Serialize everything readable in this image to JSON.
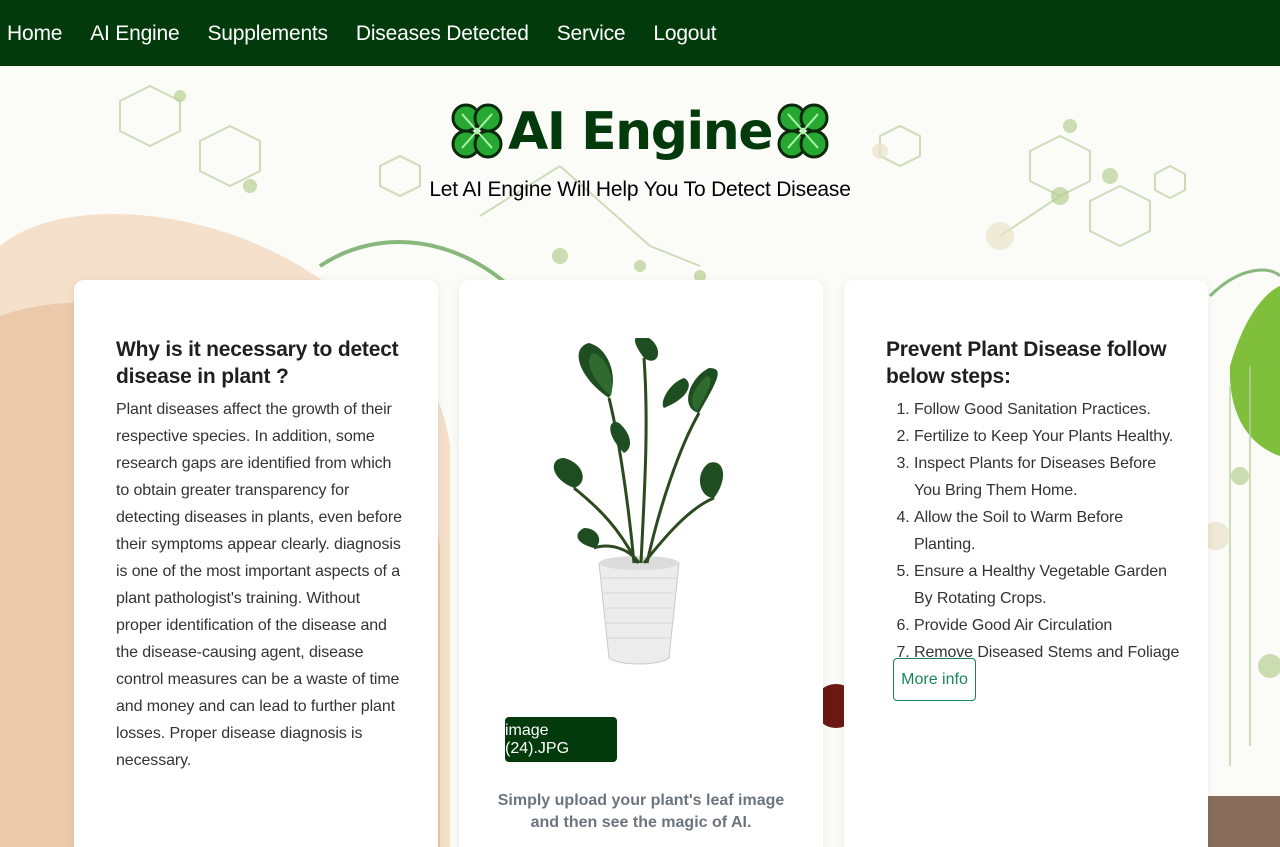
{
  "nav": {
    "items": [
      "Home",
      "AI Engine",
      "Supplements",
      "Diseases Detected",
      "Service",
      "Logout"
    ]
  },
  "header": {
    "title": "AI Engine",
    "subtitle": "Let AI Engine Will Help You To Detect Disease"
  },
  "left_card": {
    "heading": "Why is it necessary to detect disease in plant ?",
    "body": "Plant diseases affect the growth of their respective species. In addition, some research gaps are identified from which to obtain greater transparency for detecting diseases in plants, even before their symptoms appear clearly. diagnosis is one of the most important aspects of a plant pathologist's training. Without proper identification of the disease and the disease-causing agent, disease control measures can be a waste of time and money and can lead to further plant losses. Proper disease diagnosis is necessary."
  },
  "middle_card": {
    "file_button": "image (24).JPG",
    "hint": "Simply upload your plant's leaf image and then see the magic of AI."
  },
  "right_card": {
    "heading": "Prevent Plant Disease follow below steps:",
    "steps": [
      "Follow Good Sanitation Practices.",
      "Fertilize to Keep Your Plants Healthy.",
      "Inspect Plants for Diseases Before You Bring Them Home.",
      "Allow the Soil to Warm Before Planting.",
      "Ensure a Healthy Vegetable Garden By Rotating Crops.",
      "Provide Good Air Circulation",
      "Remove Diseased Stems and Foliage"
    ],
    "more_button": "More info"
  },
  "colors": {
    "nav_bg": "#023a0b",
    "title": "#023a0b",
    "accent_outline": "#198754",
    "clover_green": "#27a833"
  },
  "icons": {
    "title_left": "clover-icon",
    "title_right": "clover-icon",
    "plant_image": "potted-plant-image"
  }
}
